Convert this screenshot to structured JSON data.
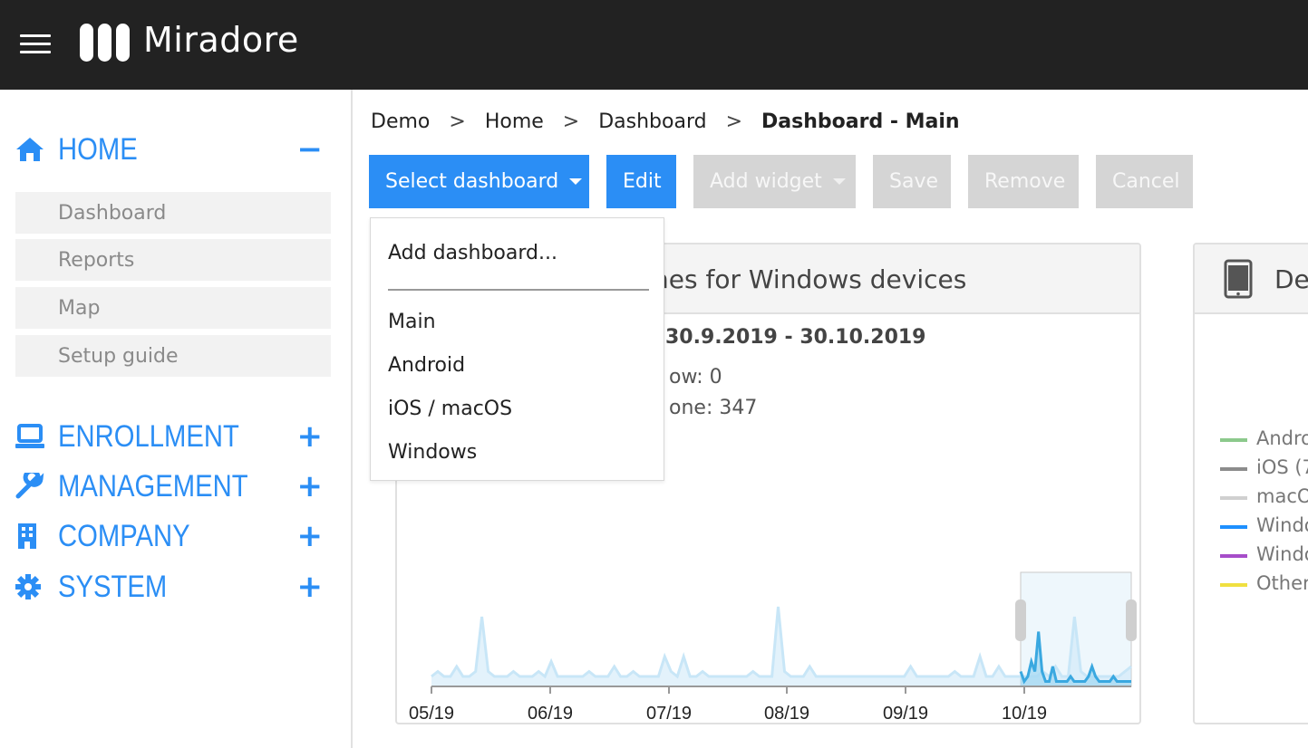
{
  "app": {
    "name": "Miradore"
  },
  "sidebar": {
    "sections": [
      {
        "label": "HOME",
        "toggle": "−",
        "icon": "home-icon"
      },
      {
        "label": "ENROLLMENT",
        "toggle": "+",
        "icon": "laptop-icon"
      },
      {
        "label": "MANAGEMENT",
        "toggle": "+",
        "icon": "wrench-icon"
      },
      {
        "label": "COMPANY",
        "toggle": "+",
        "icon": "building-icon"
      },
      {
        "label": "SYSTEM",
        "toggle": "+",
        "icon": "gear-icon"
      }
    ],
    "home_items": [
      "Dashboard",
      "Reports",
      "Map",
      "Setup guide"
    ]
  },
  "breadcrumb": {
    "items": [
      "Demo",
      "Home",
      "Dashboard",
      "Dashboard - Main"
    ],
    "separator": ">"
  },
  "toolbar": {
    "select_dashboard": "Select dashboard",
    "edit": "Edit",
    "add_widget": "Add widget",
    "save": "Save",
    "remove": "Remove",
    "cancel": "Cancel"
  },
  "dropdown": {
    "add_item": "Add dashboard...",
    "items": [
      "Main",
      "Android",
      "iOS / macOS",
      "Windows"
    ]
  },
  "widget_left": {
    "title_visible": "nes for Windows devices",
    "date_range": "30.9.2019 - 30.10.2019",
    "line1": "ow: 0",
    "line2": "one: 347"
  },
  "widget_right": {
    "title_visible": "De",
    "icon": "tablet-icon",
    "legend": [
      {
        "label": "Andro",
        "color": "#8cc98c"
      },
      {
        "label": "iOS (7",
        "color": "#8c8c8c"
      },
      {
        "label": "macO",
        "color": "#d0d0d0"
      },
      {
        "label": "Windo",
        "color": "#1e90ff"
      },
      {
        "label": "Windo",
        "color": "#a64dc9"
      },
      {
        "label": "Other",
        "color": "#f0e040"
      }
    ]
  },
  "chart_data": {
    "type": "area",
    "x_tick_labels": [
      "05/19",
      "06/19",
      "07/19",
      "08/19",
      "09/19",
      "10/19"
    ],
    "overview_values": [
      2,
      3,
      2,
      2,
      4,
      2,
      2,
      3,
      14,
      3,
      2,
      2,
      2,
      3,
      2,
      2,
      2,
      3,
      2,
      5,
      2,
      2,
      2,
      2,
      2,
      3,
      2,
      2,
      2,
      4,
      2,
      2,
      3,
      2,
      2,
      2,
      2,
      6,
      3,
      2,
      6,
      2,
      2,
      3,
      2,
      2,
      2,
      2,
      2,
      2,
      2,
      3,
      2,
      2,
      2,
      16,
      3,
      2,
      2,
      2,
      4,
      2,
      2,
      2,
      2,
      2,
      2,
      2,
      2,
      2,
      2,
      2,
      2,
      2,
      2,
      2,
      4,
      2,
      2,
      2,
      2,
      2,
      2,
      3,
      2,
      2,
      2,
      6,
      2,
      2,
      4,
      2,
      2,
      2,
      2,
      2,
      2,
      3,
      2,
      4,
      2,
      2,
      14,
      3,
      2,
      2,
      2,
      2,
      2,
      2,
      3,
      4
    ],
    "selected_values": [
      3,
      1,
      2,
      5,
      3,
      11,
      3,
      1,
      1,
      4,
      1,
      1,
      1,
      1,
      2,
      1,
      1,
      1,
      1,
      2,
      4,
      2,
      1,
      1,
      1,
      1,
      2,
      1,
      1,
      1,
      1,
      1
    ],
    "selection_label": "10/19",
    "colors": {
      "overview": "#c8e6f7",
      "selected_line": "#3aa8e0",
      "selected_fill": "#a7d9f2",
      "selection_bg": "#eef7fc"
    }
  }
}
